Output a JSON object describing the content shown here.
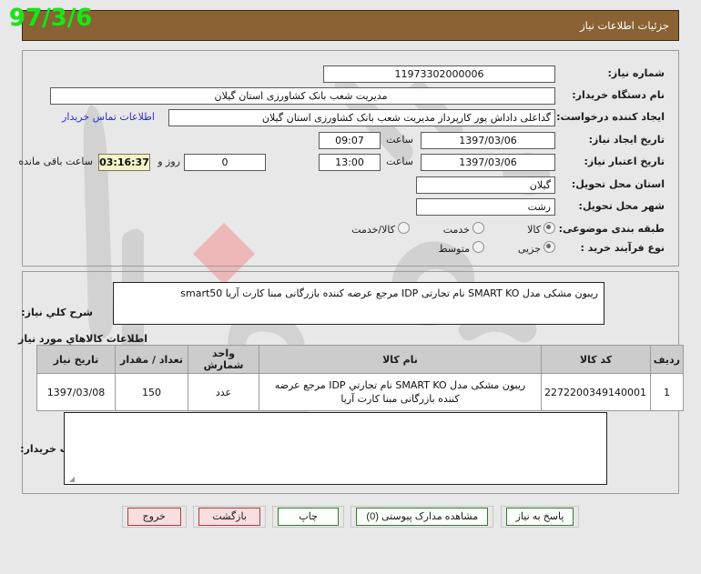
{
  "header": {
    "title": "جزئیات اطلاعات نیاز",
    "date_badge": "97/3/6",
    "bar_color": "#8a6233",
    "date_color": "#19e619"
  },
  "form": {
    "need_number": {
      "label": "شماره نیاز:",
      "value": "11973302000006"
    },
    "buyer_org": {
      "label": "نام دستگاه خریدار:",
      "value": "مدیریت شعب بانک کشاورزی استان گیلان"
    },
    "requester": {
      "label": "ایجاد کننده درخواست:",
      "value": "گداعلی داداش پور کارپرداز مدیریت شعب بانک کشاورزی استان گیلان",
      "contact_link": "اطلاعات تماس خریدار"
    },
    "create_date": {
      "label": "تاریخ ایجاد نیاز:",
      "date": "1397/03/06",
      "time_label": "ساعت",
      "time": "09:07"
    },
    "expire_date": {
      "label": "تاریخ اعتبار نیاز:",
      "date": "1397/03/06",
      "time_label": "ساعت",
      "time": "13:00",
      "days_remaining": "0",
      "days_label": "روز و",
      "countdown": "03:16:37",
      "remaining_label": "ساعت باقی مانده"
    },
    "province": {
      "label": "استان محل تحویل:",
      "value": "گیلان"
    },
    "city": {
      "label": "شهر محل تحویل:",
      "value": "رشت"
    },
    "category": {
      "label": "طبقه بندی موضوعی:",
      "options": [
        "کالا",
        "خدمت",
        "کالا/خدمت"
      ],
      "selected": "کالا"
    },
    "process_type": {
      "label": "نوع فرآیند خرید :",
      "options": [
        "جزیی",
        "متوسط"
      ],
      "selected": "جزیی"
    }
  },
  "description": {
    "label": "شرح کلي نیاز:",
    "value": "ریبون مشکی مدل SMART KO نام تجارتی IDP مرجع عرضه کننده بازرگانی مبنا کارت آریا smart50"
  },
  "goods": {
    "section_label": "اطلاعات کالاهاي مورد نیاز",
    "columns": [
      "ردیف",
      "کد کالا",
      "نام کالا",
      "واحد شمارش",
      "تعداد / مقدار",
      "تاریخ نیاز"
    ],
    "rows": [
      {
        "row": "1",
        "code": "2272200349140001",
        "name": "ریبون مشکی مدل SMART KO نام تجارتي IDP مرجع عرضه کننده بازرگانی مبنا کارت آریا",
        "unit": "عدد",
        "quantity": "150",
        "need_date": "1397/03/08"
      }
    ]
  },
  "buyer_notes": {
    "label": "توضیحات خریدار:",
    "value": ""
  },
  "buttons": [
    {
      "label": "پاسخ به نیاز",
      "style": "green"
    },
    {
      "label": "مشاهده مدارک پیوستی (0)",
      "style": "green"
    },
    {
      "label": "چاپ",
      "style": "green"
    },
    {
      "label": "بازگشت",
      "style": "pink"
    },
    {
      "label": "خروج",
      "style": "pink"
    }
  ]
}
